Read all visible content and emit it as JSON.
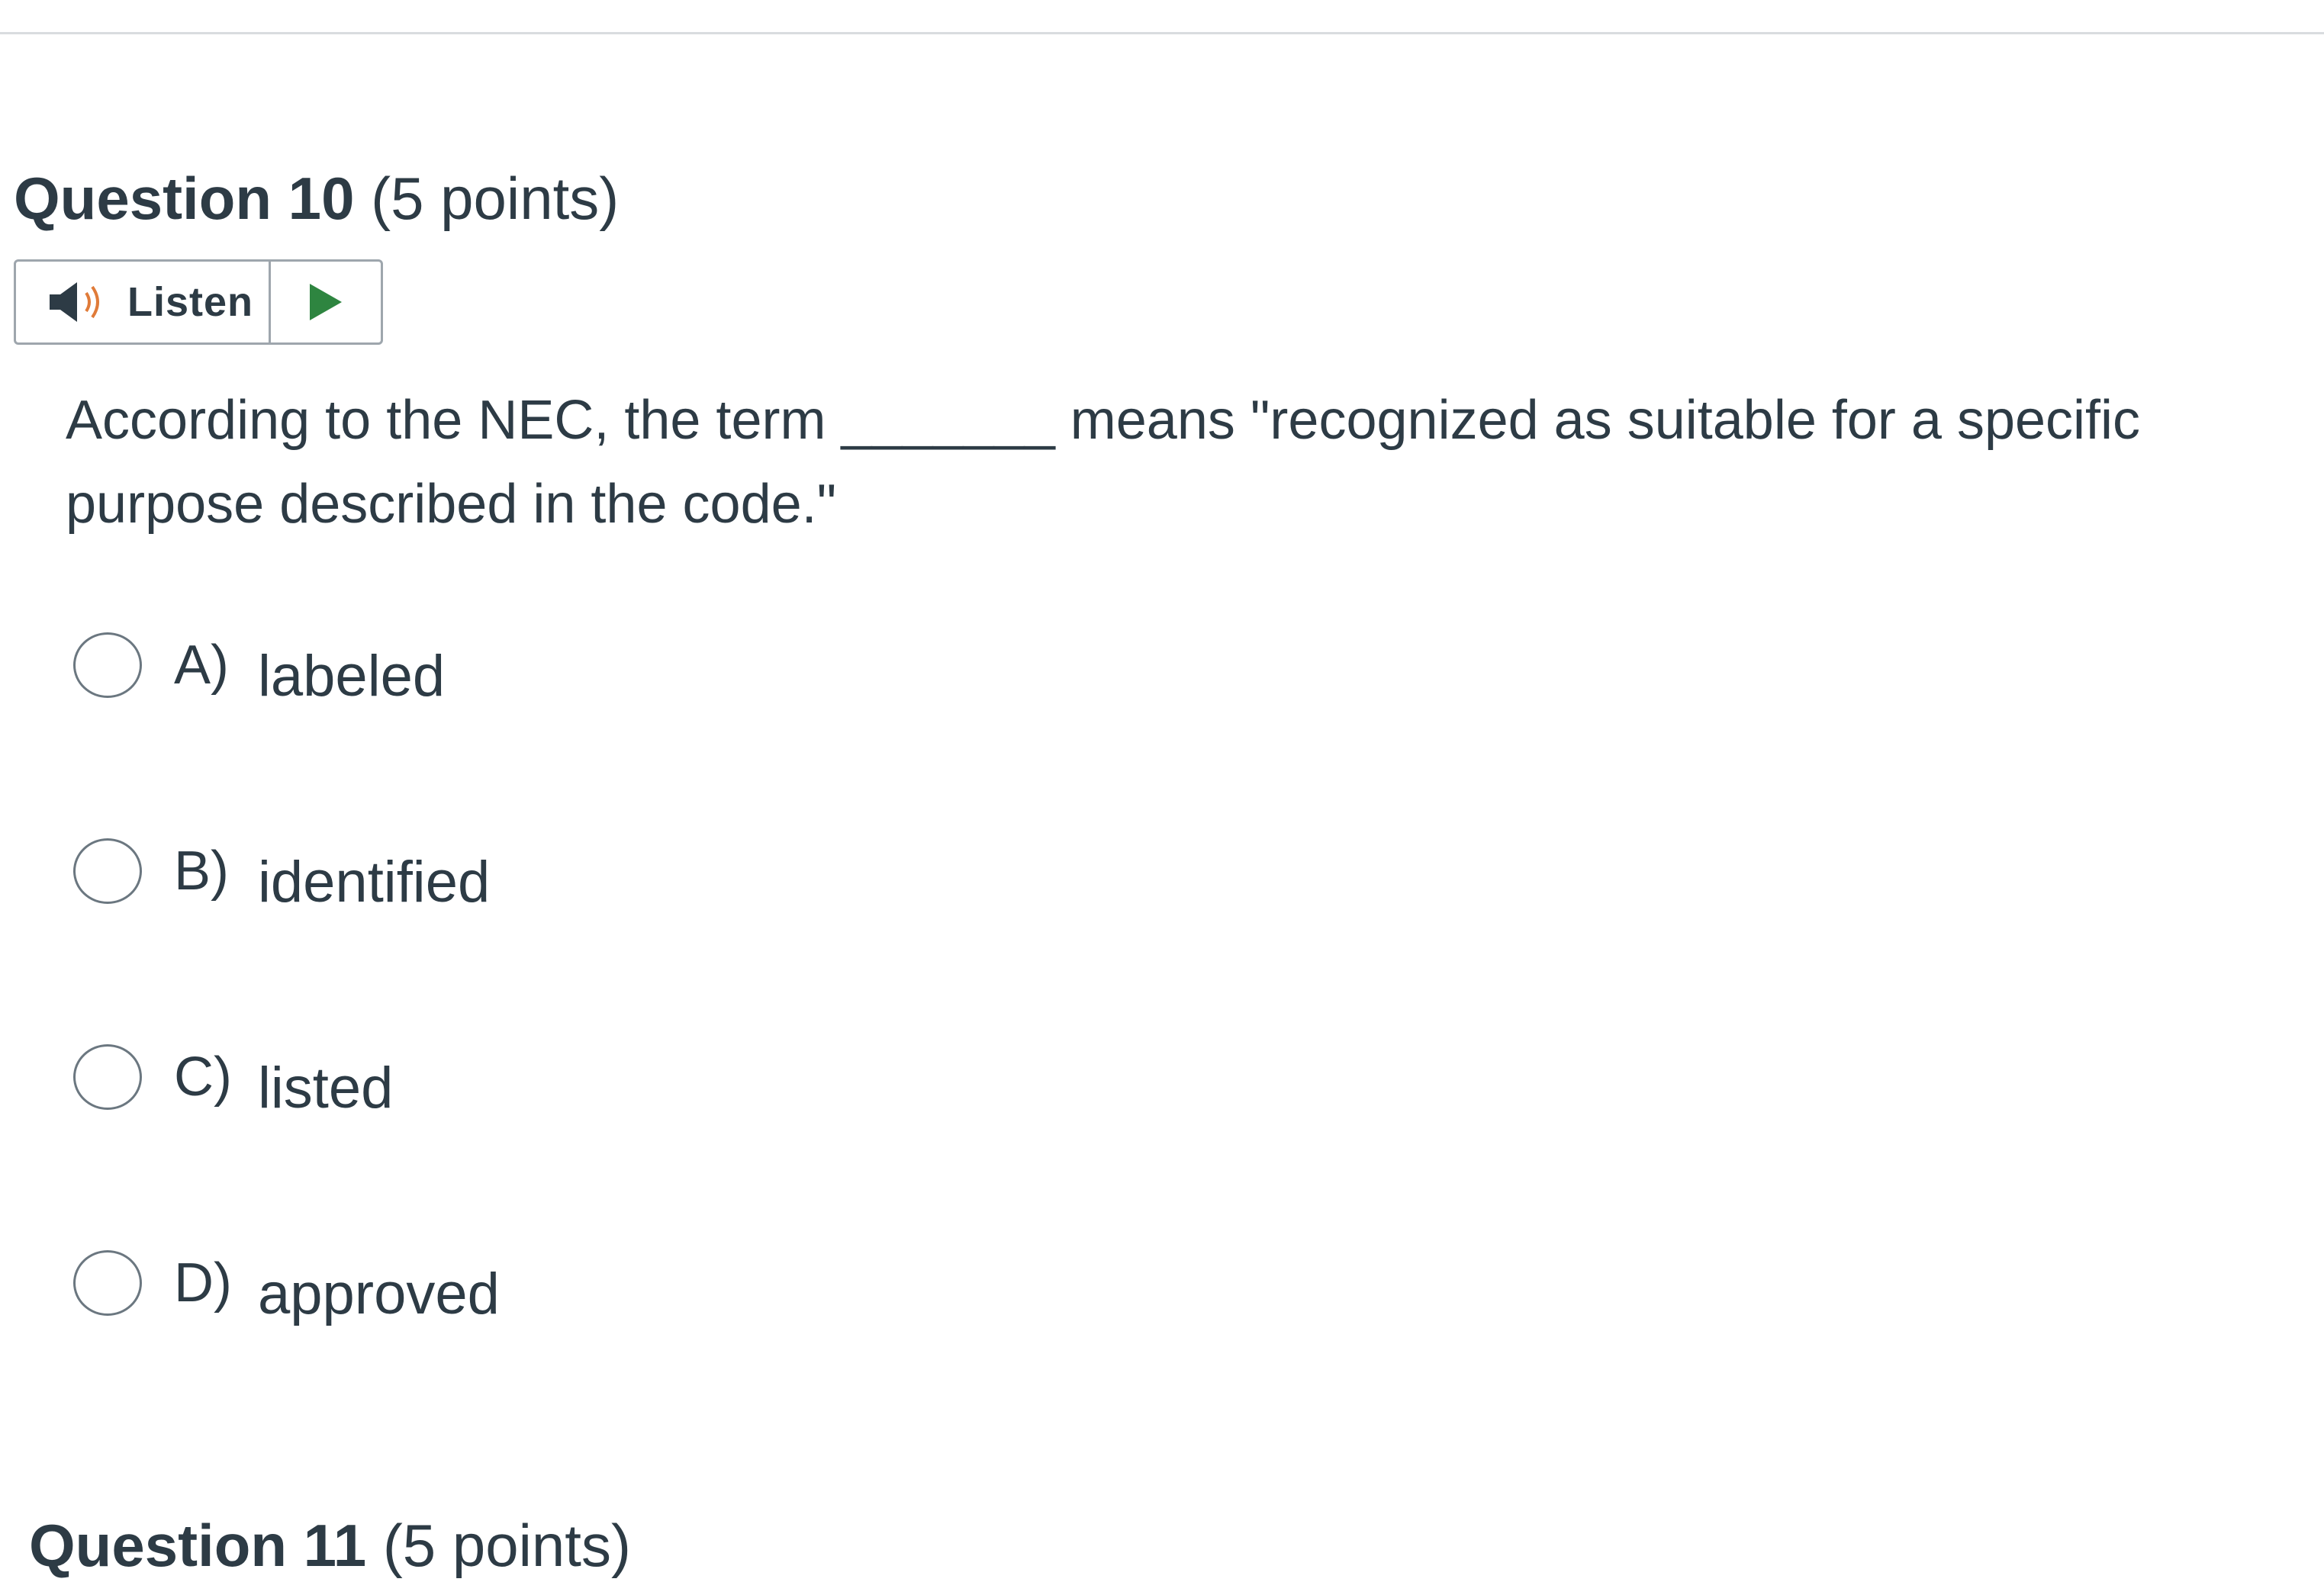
{
  "question": {
    "title": "Question 10",
    "points": "(5 points)"
  },
  "listen": {
    "label": "Listen",
    "speaker_icon": "speaker-icon",
    "play_icon": "play-icon",
    "play_color": "#2e8540",
    "speaker_wave_color": "#e07b39"
  },
  "prompt": {
    "before_blank": "According to the NEC, the term ",
    "blank": "_______",
    "after_blank": " means \"recognized as suitable for a specific purpose described in the code.\""
  },
  "answers": [
    {
      "letter": "A)",
      "text": "labeled"
    },
    {
      "letter": "B)",
      "text": "identified"
    },
    {
      "letter": "C)",
      "text": "listed"
    },
    {
      "letter": "D)",
      "text": "approved"
    }
  ],
  "next_question": {
    "title": "Question 11",
    "points": "(5 points)"
  }
}
